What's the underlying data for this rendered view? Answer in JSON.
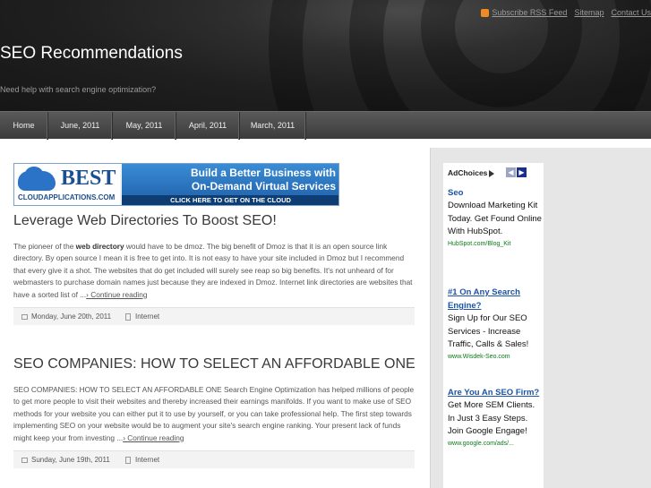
{
  "header": {
    "links": [
      "Subscribe RSS Feed",
      "Sitemap",
      "Contact Us"
    ],
    "site_title": "SEO Recommendations",
    "tagline": "Need help with search engine optimization?"
  },
  "nav": {
    "items": [
      "Home",
      "June, 2011",
      "May, 2011",
      "April, 2011",
      "March, 2011"
    ]
  },
  "banner": {
    "brand": "BEST",
    "site": "CLOUDAPPLICATIONS.COM",
    "headline_1": "Build a Better Business with",
    "headline_2": "On-Demand Virtual Services",
    "cta": "CLICK HERE TO GET ON THE CLOUD"
  },
  "posts": [
    {
      "title": "Leverage Web Directories To Boost SEO!",
      "body_prefix": "The pioneer of the ",
      "body_bold": "web directory",
      "body_rest": " would have to be dmoz. The big benefit of Dmoz is that it is an open source link directory. By open source I mean it is free to get into. It is not easy to have your site included in Dmoz but I recommend that every give it a shot. The websites that do get included will surely see reap so big benefits. It's not unheard of for webmasters to purchase domain names just because they are indexed in Dmoz. Internet link directories are websites that have a sorted list of ...",
      "continue": "› Continue reading",
      "date": "Monday, June 20th, 2011",
      "category": "Internet"
    },
    {
      "title": "SEO COMPANIES: HOW TO SELECT AN AFFORDABLE ONE",
      "body": "SEO COMPANIES: HOW TO SELECT AN AFFORDABLE ONE Search Engine Optimization has helped millions of people to get more people to visit their websites and thereby increased their earnings manifolds. If you want to make use of SEO methods for your website you can either put it to use by yourself, or you can take professional help. The first step towards implementing SEO on your website would be to augment your site's search engine ranking. Your present lack of funds might keep your from investing ...",
      "continue": "› Continue reading",
      "date": "Sunday, June 19th, 2011",
      "category": "Internet"
    }
  ],
  "ads": {
    "adchoices": "AdChoices",
    "items": [
      {
        "title": "Seo",
        "desc": "Download Marketing Kit Today. Get Found Online With HubSpot.",
        "url": "HubSpot.com/Blog_Kit"
      },
      {
        "title": "#1 On Any Search Engine?",
        "desc": "Sign Up for Our SEO Services - Increase Traffic, Calls & Sales!",
        "url": "www.Wisdek-Seo.com"
      },
      {
        "title": "Are You An SEO Firm?",
        "desc": "Get More SEM Clients. In Just 3 Easy Steps. Join Google Engage!",
        "url": "www.google.com/ads/..."
      }
    ]
  },
  "colors": {
    "header_bg": "#1f1f1f",
    "nav_bg": "#4a4a4a",
    "ad_link": "#1a53a8",
    "ad_url": "#0a7a1a",
    "rss": "#f08a24"
  }
}
